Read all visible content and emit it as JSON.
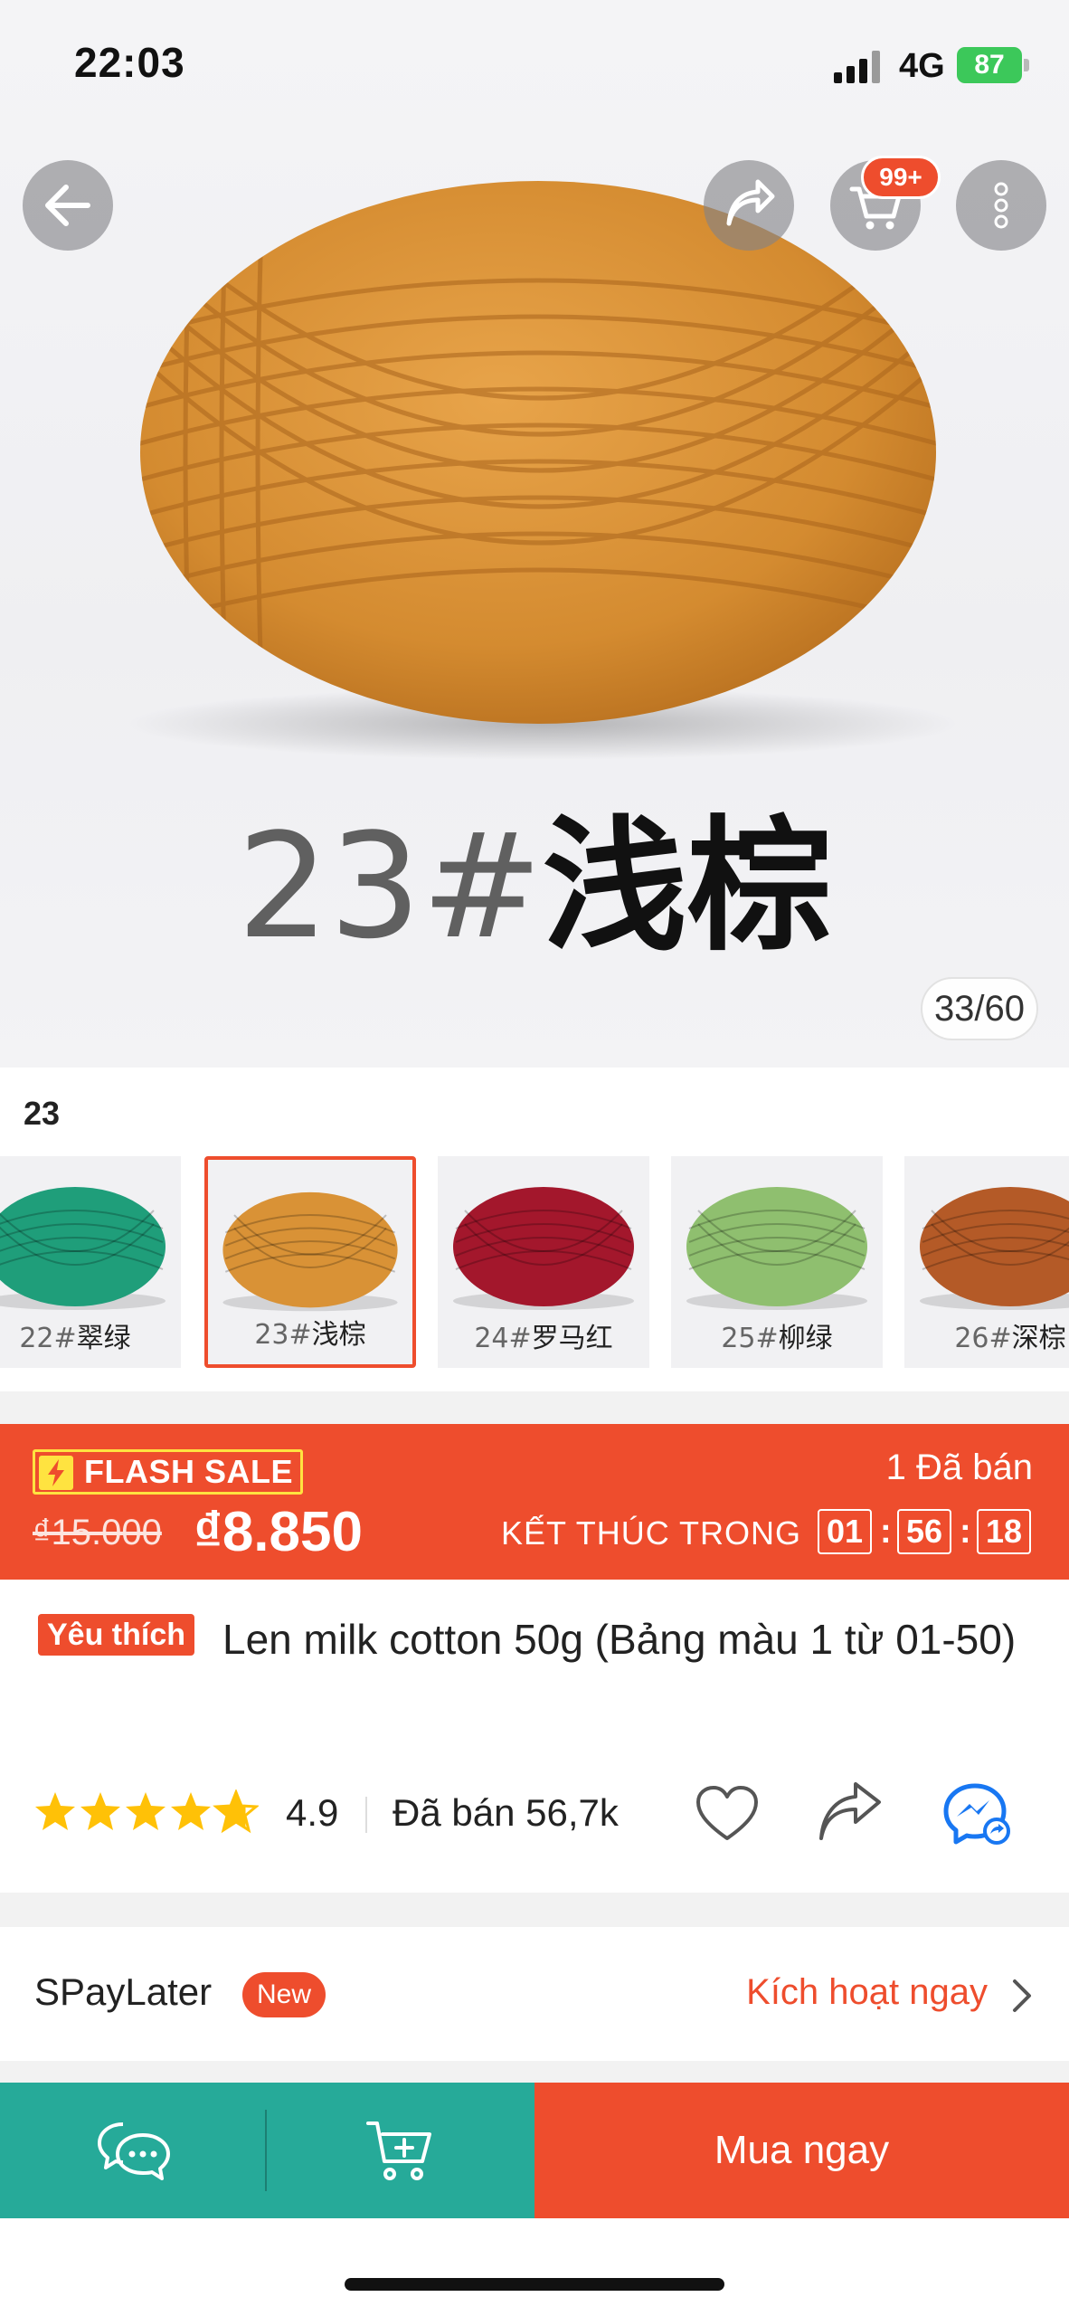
{
  "status_bar": {
    "time": "22:03",
    "network": "4G",
    "battery": "87"
  },
  "header": {
    "cart_badge": "99+"
  },
  "hero": {
    "caption_number": "23#",
    "caption_name": "浅棕",
    "image_counter": "33/60",
    "yarn_color": "#D99236"
  },
  "variation": {
    "selected_label": "23",
    "thumbnails": [
      {
        "num": "22#",
        "name": "翠绿",
        "color": "#1f9e7a",
        "selected": false
      },
      {
        "num": "23#",
        "name": "浅棕",
        "color": "#d99236",
        "selected": true
      },
      {
        "num": "24#",
        "name": "罗马红",
        "color": "#a3172c",
        "selected": false
      },
      {
        "num": "25#",
        "name": "柳绿",
        "color": "#8fbf6f",
        "selected": false
      },
      {
        "num": "26#",
        "name": "深棕",
        "color": "#b45a27",
        "selected": false
      }
    ]
  },
  "flash_sale": {
    "label": "FLASH SALE",
    "sold": "1 Đã bán",
    "price_old": "₫15.000",
    "price_new": "₫8.850",
    "countdown_label": "KẾT THÚC TRONG",
    "hours": "01",
    "minutes": "56",
    "seconds": "18"
  },
  "product": {
    "badge": "Yêu thích",
    "title": "Len milk cotton 50g (Bảng màu 1 từ 01-50)",
    "rating": 4.9,
    "rating_text": "4.9",
    "sold": "Đã bán 56,7k"
  },
  "spaylater": {
    "label": "SPayLater",
    "new_badge": "New",
    "link": "Kích hoạt ngay"
  },
  "bottom_bar": {
    "buy_now": "Mua ngay"
  },
  "colors": {
    "brand": "#EE4D2D",
    "teal": "#26AA99",
    "star": "#FFC107",
    "flash_yellow": "#FFE340"
  }
}
